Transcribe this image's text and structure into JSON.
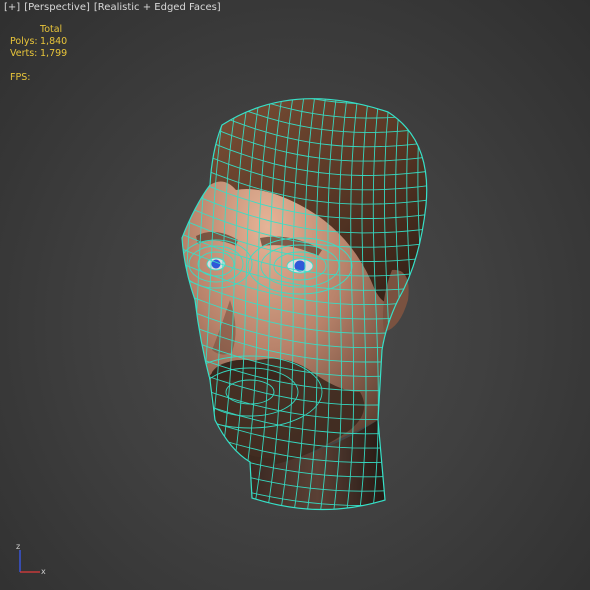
{
  "viewport": {
    "plus_label": "[+]",
    "view_label": "[Perspective]",
    "shading_label": "[Realistic + Edged Faces]"
  },
  "stats": {
    "total_header": "Total",
    "polys_label": "Polys:",
    "polys_value": "1,840",
    "verts_label": "Verts:",
    "verts_value": "1,799",
    "fps_label": "FPS:"
  },
  "colors": {
    "wire": "#36e0c8",
    "stats_text": "#e8c53a",
    "eye_iris": "#2f57d8"
  },
  "axis_gizmo": {
    "z_label": "z",
    "x_label": "x"
  },
  "model_icon": "wireframe-head-model"
}
